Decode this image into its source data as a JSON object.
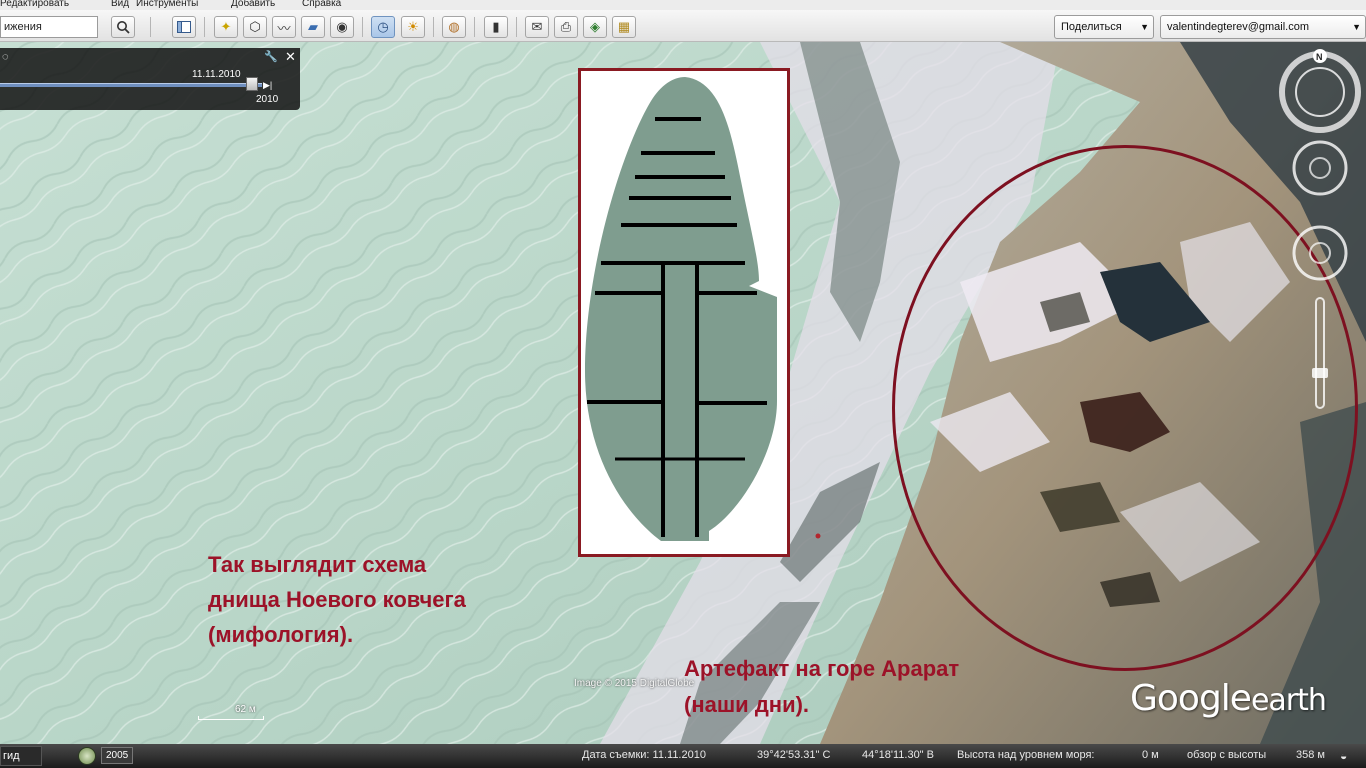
{
  "menu": {
    "items": [
      "Редактировать",
      "Вид",
      "Инструменты",
      "Добавить",
      "Справка"
    ]
  },
  "toolbar": {
    "search_value": "ижения",
    "share_label": "Поделиться",
    "account_label": "valentindegterev@gmail.com"
  },
  "time_slider": {
    "date": "11.11.2010",
    "end_year": "2010",
    "position": 0.96
  },
  "map": {
    "imagery_credit": "Image © 2015 DigitalGlobe",
    "scale": "62 м",
    "logo_main": "Google",
    "logo_sub": "earth"
  },
  "captions": {
    "left": [
      "Так выглядит схема",
      "днища Ноевого ковчега",
      "(мифология)."
    ],
    "right": [
      "Артефакт на горе Арарат",
      "(наши дни)."
    ]
  },
  "status": {
    "tab_label": "гид",
    "year": "2005",
    "capture_date": "Дата съемки: 11.11.2010",
    "lat": "39°42'53.31\" С",
    "lon": "44°18'11.30\" В",
    "altitude": "Высота над уровнем моря:",
    "altitude_value": "0 м",
    "view": "обзор с высоты",
    "view_value": "358 м"
  },
  "colors": {
    "caption": "#9c1228",
    "diagram_border": "#8a1a22",
    "diagram_fill": "#7f9d8f",
    "ellipse": "#7d1020"
  }
}
